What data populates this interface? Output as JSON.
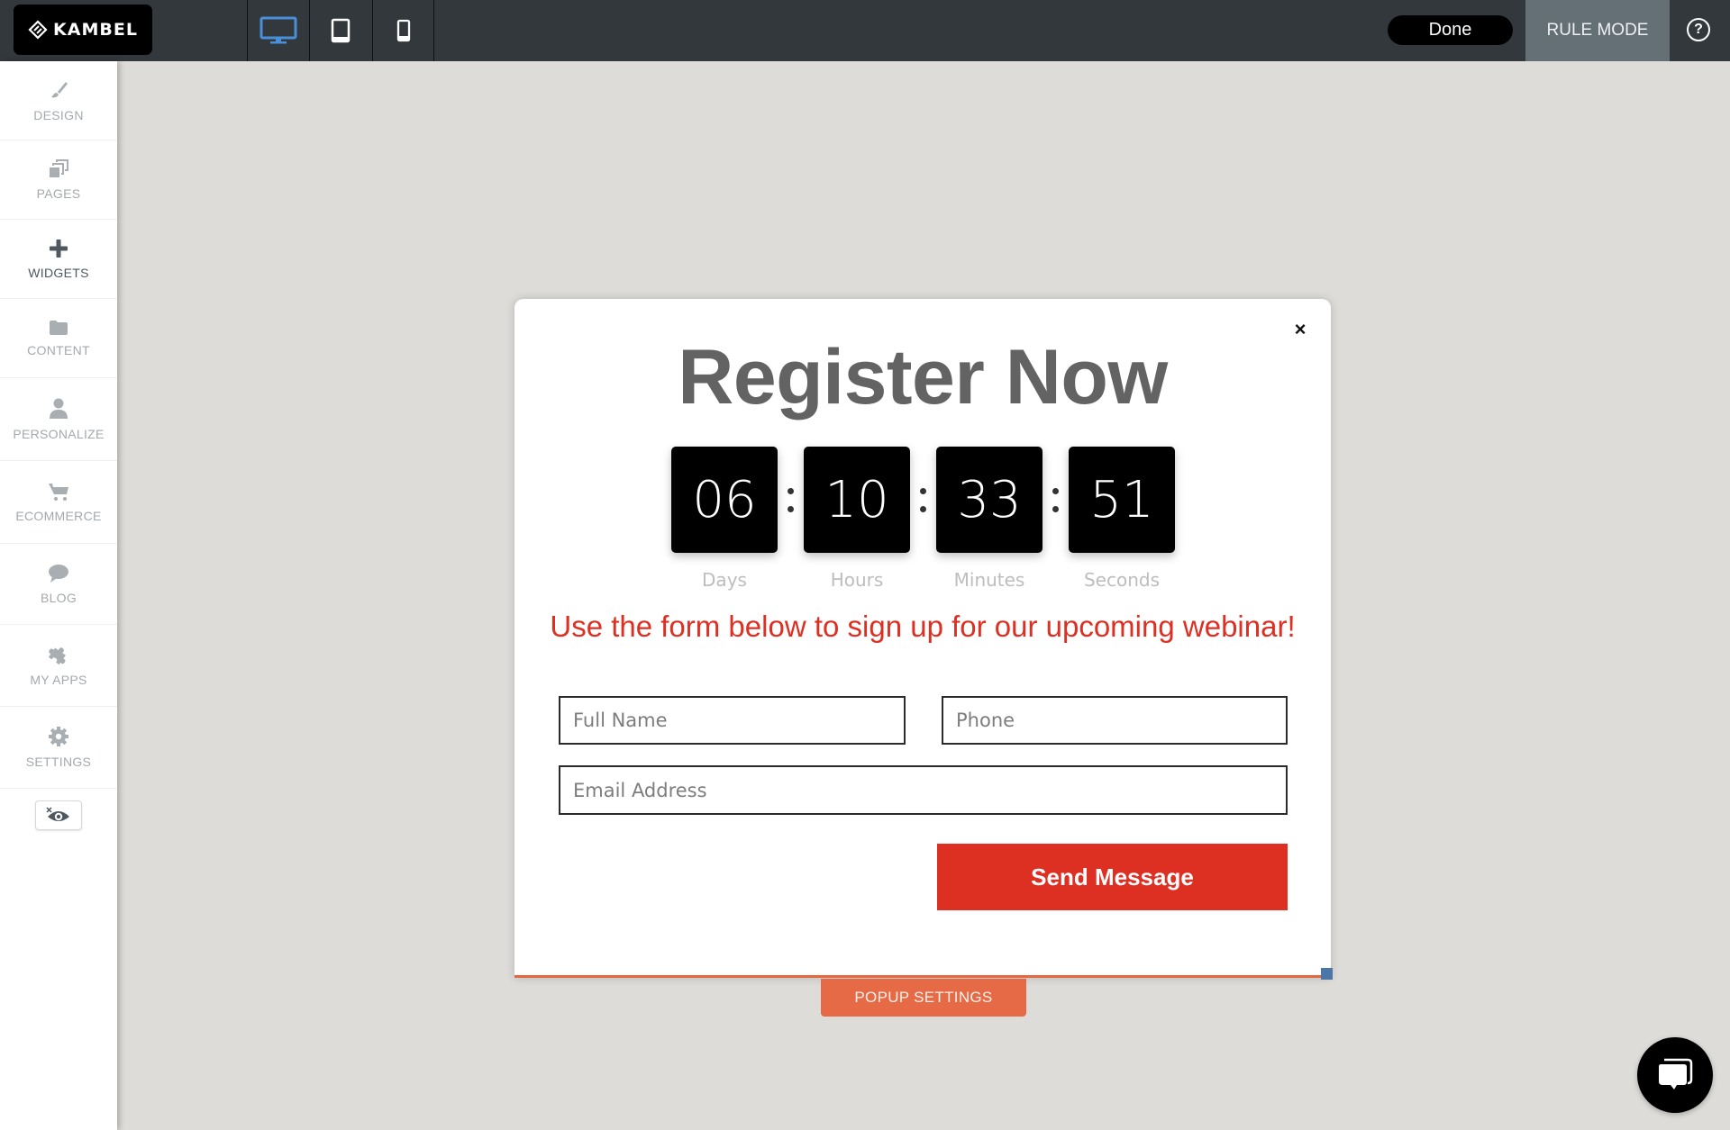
{
  "topbar": {
    "logo_text": "KAMBEL",
    "devices": [
      {
        "name": "desktop",
        "active": true
      },
      {
        "name": "tablet",
        "active": false
      },
      {
        "name": "mobile",
        "active": false
      }
    ],
    "done_label": "Done",
    "rule_mode_label": "RULE MODE",
    "help_label": "?"
  },
  "sidebar": {
    "items": [
      {
        "label": "DESIGN",
        "icon": "paintbrush-icon",
        "active": false
      },
      {
        "label": "PAGES",
        "icon": "pages-icon",
        "active": false
      },
      {
        "label": "WIDGETS",
        "icon": "plus-icon",
        "active": true
      },
      {
        "label": "CONTENT",
        "icon": "folder-icon",
        "active": false
      },
      {
        "label": "PERSONALIZE",
        "icon": "user-icon",
        "active": false
      },
      {
        "label": "ECOMMERCE",
        "icon": "cart-icon",
        "active": false
      },
      {
        "label": "BLOG",
        "icon": "speech-bubble-icon",
        "active": false
      },
      {
        "label": "MY APPS",
        "icon": "puzzle-icon",
        "active": false
      },
      {
        "label": "SETTINGS",
        "icon": "gear-icon",
        "active": false
      }
    ],
    "preview_toggle_icon": "hidden-eye-icon"
  },
  "popup": {
    "close_label": "×",
    "headline": "Register Now",
    "countdown": [
      {
        "value": "06",
        "label": "Days"
      },
      {
        "value": "10",
        "label": "Hours"
      },
      {
        "value": "33",
        "label": "Minutes"
      },
      {
        "value": "51",
        "label": "Seconds"
      }
    ],
    "subtitle": "Use the form below to sign up for our upcoming webinar!",
    "form": {
      "full_name": {
        "value": "",
        "placeholder": "Full Name"
      },
      "phone": {
        "value": "",
        "placeholder": "Phone"
      },
      "email": {
        "value": "",
        "placeholder": "Email Address"
      },
      "submit_label": "Send Message"
    },
    "settings_tab_label": "POPUP SETTINGS"
  },
  "colors": {
    "topbar_bg": "#33383d",
    "accent_blue": "#4a90d9",
    "brand_red": "#dd3023",
    "popup_settings_orange": "#e66a46",
    "canvas_bg": "#dedcd9"
  }
}
